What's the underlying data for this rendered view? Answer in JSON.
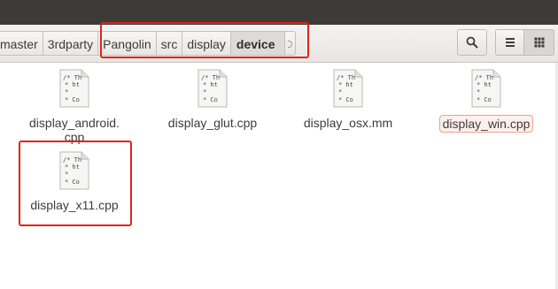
{
  "breadcrumb": {
    "items": [
      "master",
      "3rdparty",
      "Pangolin",
      "src",
      "display",
      "device"
    ],
    "active": "device"
  },
  "toolbar": {
    "search_icon": "search-icon",
    "list_view_icon": "list-view-icon",
    "grid_view_icon": "grid-view-icon"
  },
  "files": [
    {
      "name": "display_android.\ncpp",
      "icon": "cpp-file-icon",
      "selected": false,
      "thumb": [
        "/* Th",
        "* ht",
        "*",
        "* Co"
      ]
    },
    {
      "name": "display_glut.cpp",
      "icon": "cpp-file-icon",
      "selected": false,
      "thumb": [
        "/* Th",
        "* ht",
        "*",
        "* Co"
      ]
    },
    {
      "name": "display_osx.mm",
      "icon": "mm-file-icon",
      "selected": false,
      "thumb": [
        "/* Th",
        "* ht",
        "*",
        "* Co"
      ]
    },
    {
      "name": "display_win.cpp",
      "icon": "cpp-file-icon",
      "selected": true,
      "thumb": [
        "/* Th",
        "* ht",
        "*",
        "* Co"
      ]
    },
    {
      "name": "display_x11.cpp",
      "icon": "cpp-file-icon",
      "selected": false,
      "thumb": [
        "/* Th",
        "* ht",
        "*",
        "* Co"
      ]
    }
  ],
  "colors": {
    "annotation": "#e2231a",
    "selection_border": "#f0a08a"
  }
}
